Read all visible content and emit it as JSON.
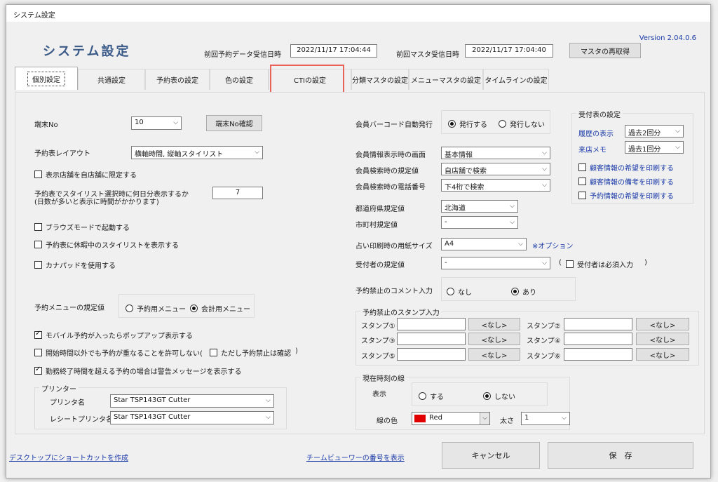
{
  "window": {
    "title": "システム設定"
  },
  "header": {
    "title": "システム設定",
    "version": "Version 2.04.0.6",
    "last_reservation_label": "前回予約データ受信日時",
    "last_reservation_value": "2022/11/17 17:04:44",
    "last_master_label": "前回マスタ受信日時",
    "last_master_value": "2022/11/17 17:04:40",
    "reacquire_master_button": "マスタの再取得"
  },
  "tabs": [
    {
      "label": "個別設定",
      "active": true
    },
    {
      "label": "共通設定"
    },
    {
      "label": "予約表の設定"
    },
    {
      "label": "色の設定"
    },
    {
      "label": "CTIの設定",
      "highlighted": true
    },
    {
      "label": "分類マスタの設定"
    },
    {
      "label": "メニューマスタの設定"
    },
    {
      "label": "タイムラインの設定"
    }
  ],
  "highlight_color": "#e8625a",
  "left": {
    "terminal_no_label": "端末No",
    "terminal_no_value": "10",
    "terminal_no_confirm_button": "端末No確認",
    "layout_label": "予約表レイアウト",
    "layout_value": "横軸時間, 縦軸スタイリスト",
    "limit_store_label": "表示店舗を自店舗に限定する",
    "days_label_1": "予約表でスタイリスト選択時に何日分表示するか",
    "days_label_2": "(日数が多いと表示に時間がかかります)",
    "days_value": "7",
    "browse_mode_label": "ブラウズモードで起動する",
    "show_resting_label": "予約表に休暇中のスタイリストを表示する",
    "kana_pad_label": "カナパッドを使用する",
    "menu_default_label": "予約メニューの規定値",
    "menu_option_reservation": "予約用メニュー",
    "menu_option_accounting": "会計用メニュー",
    "mobile_popup_label": "モバイル予約が入ったらポップアップ表示する",
    "overlap_label": "開始時間以外でも予約が重なることを許可しない(",
    "overlap_sub_label": "ただし予約禁止は確認",
    "overlap_close": ")",
    "overtime_warning_label": "勤務終了時間を超える予約の場合は警告メッセージを表示する",
    "printer_group": "プリンター",
    "printer_name_label": "プリンタ名",
    "printer_name_value": "Star TSP143GT Cutter",
    "receipt_printer_label": "レシートプリンタ名",
    "receipt_printer_value": "Star TSP143GT Cutter"
  },
  "right": {
    "member_barcode_label": "会員バーコード自動発行",
    "issue_yes": "発行する",
    "issue_no": "発行しない",
    "member_info_screen_label": "会員情報表示時の画面",
    "member_info_screen_value": "基本情報",
    "member_search_default_label": "会員検索時の規定値",
    "member_search_default_value": "自店舗で検索",
    "member_search_phone_label": "会員検索時の電話番号",
    "member_search_phone_value": "下4桁で検索",
    "prefecture_label": "都道府県規定値",
    "prefecture_value": "北海道",
    "city_label": "市町村規定値",
    "city_value": "-",
    "fortune_paper_label": "占い印刷時の用紙サイズ",
    "fortune_paper_value": "A4",
    "option_note": "※オプション",
    "receiver_default_label": "受付者の規定値",
    "receiver_default_value": "-",
    "receiver_required_open": "(",
    "receiver_required_label": "受付者は必須入力",
    "receiver_required_close": ")",
    "ban_comment_label": "予約禁止のコメント入力",
    "ban_none": "なし",
    "ban_yes": "あり",
    "stamp_group": "予約禁止のスタンプ入力",
    "stamps": [
      {
        "label": "スタンプ①",
        "value": "",
        "button": "<なし>"
      },
      {
        "label": "スタンプ②",
        "value": "",
        "button": "<なし>"
      },
      {
        "label": "スタンプ③",
        "value": "",
        "button": "<なし>"
      },
      {
        "label": "スタンプ④",
        "value": "",
        "button": "<なし>"
      },
      {
        "label": "スタンプ⑤",
        "value": "",
        "button": "<なし>"
      },
      {
        "label": "スタンプ⑥",
        "value": "",
        "button": "<なし>"
      }
    ],
    "timeline_group": "現在時刻の線",
    "display_label": "表示",
    "display_yes": "する",
    "display_no": "しない",
    "line_color_label": "線の色",
    "line_color_value": "Red",
    "line_color_hex": "#e00000",
    "thickness_label": "太さ",
    "thickness_value": "1"
  },
  "reception": {
    "group": "受付表の設定",
    "history_label": "履歴の表示",
    "history_value": "過去2回分",
    "visit_memo_label": "来店メモ",
    "visit_memo_value": "過去1回分",
    "print_customer_wish": "顧客情報の希望を印刷する",
    "print_customer_notes": "顧客情報の備考を印刷する",
    "print_reservation_wish": "予約情報の希望を印刷する"
  },
  "footer": {
    "desktop_shortcut_link": "デスクトップにショートカットを作成",
    "team_viewer_link": "チームビューワーの番号を表示",
    "cancel_button": "キャンセル",
    "save_button": "保　存"
  }
}
